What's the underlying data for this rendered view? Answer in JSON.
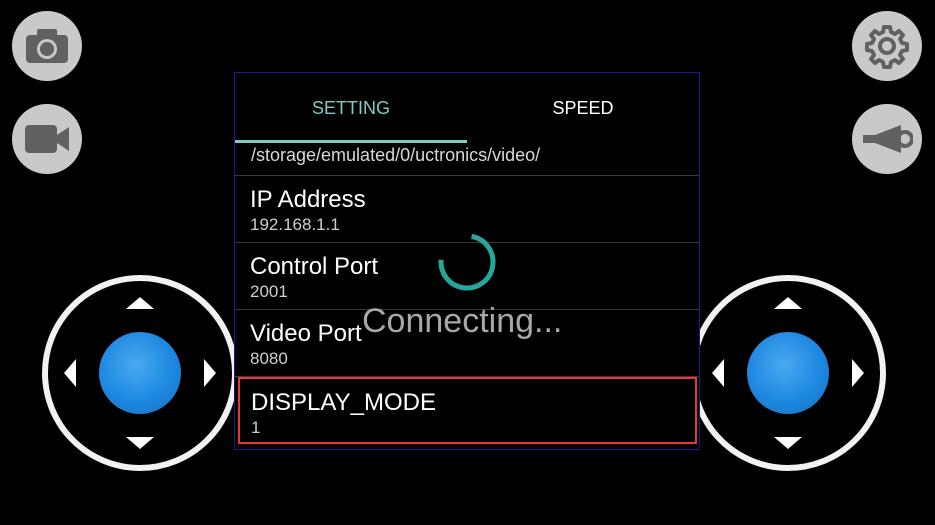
{
  "colors": {
    "accent": "#80cbc4",
    "knob": "#1e88e0",
    "button_bg": "#c9c9c9",
    "highlight": "#e53935"
  },
  "left_buttons": [
    {
      "icon": "camera-icon"
    },
    {
      "icon": "video-camera-icon"
    }
  ],
  "right_buttons": [
    {
      "icon": "gear-icon"
    },
    {
      "icon": "horn-icon"
    }
  ],
  "tabs": [
    {
      "label": "SETTING",
      "active": true
    },
    {
      "label": "SPEED",
      "active": false
    }
  ],
  "settings": {
    "path": "/storage/emulated/0/uctronics/video/",
    "items": [
      {
        "label": "IP Address",
        "value": "192.168.1.1"
      },
      {
        "label": "Control Port",
        "value": "2001"
      },
      {
        "label": "Video Port",
        "value": "8080"
      },
      {
        "label": "DISPLAY_MODE",
        "value": "1"
      }
    ]
  },
  "overlay": {
    "text": "Connecting..."
  }
}
